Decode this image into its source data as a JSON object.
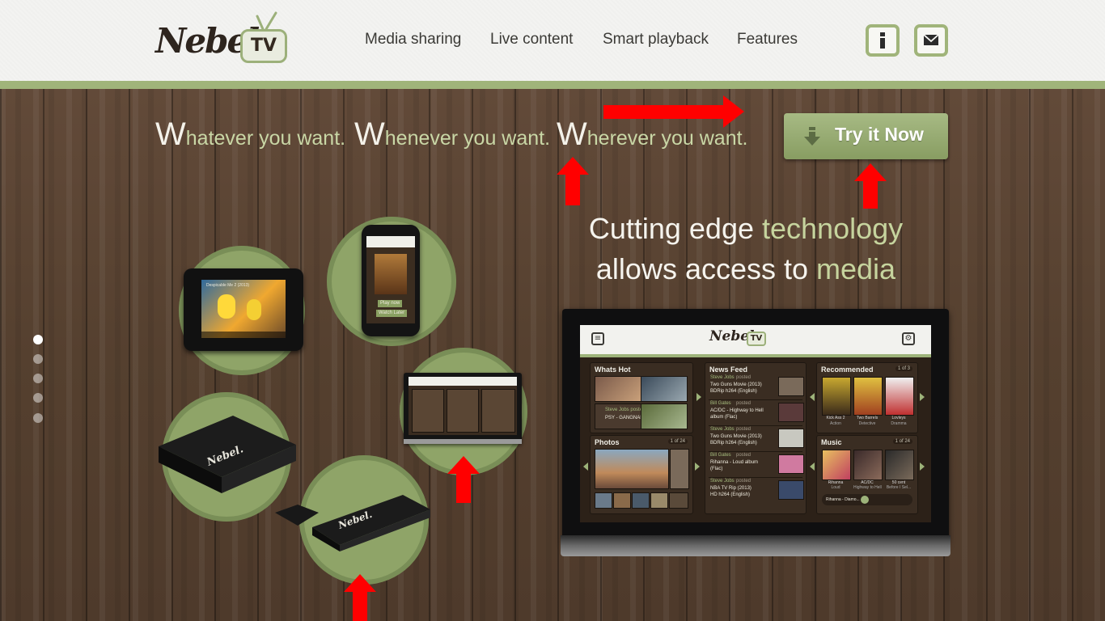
{
  "header": {
    "logo_text": "Nebel.",
    "logo_tv_text": "TV",
    "nav": [
      "Media sharing",
      "Live content",
      "Smart playback",
      "Features"
    ],
    "info_button": "i",
    "mail_button": "mail-icon"
  },
  "tagline": [
    {
      "cap": "W",
      "rest": "hatever you want."
    },
    {
      "cap": "W",
      "rest": "henever you want."
    },
    {
      "cap": "W",
      "rest": "herever you want."
    }
  ],
  "cta": {
    "label": "Try it Now",
    "icon": "download-arrow-icon"
  },
  "headline": {
    "line1_a": "Cutting edge ",
    "line1_b": "technology",
    "line2_a": "allows access to ",
    "line2_b": "media"
  },
  "slider": {
    "count": 5,
    "active": 0
  },
  "tv_ui": {
    "logo_text": "Nebel.",
    "logo_tv_text": "TV",
    "panels": {
      "whats_hot": {
        "title": "Whats Hot",
        "items": [
          "Steve Jobs posted",
          "PSY - GANGNAM STYLE"
        ]
      },
      "news_feed": {
        "title": "News Feed",
        "items": [
          {
            "user": "Steve Jobs",
            "action": "posted",
            "text1": "Two Guns Movie (2013)",
            "text2": "BDRip h264 (English)"
          },
          {
            "user": "Bill Gates",
            "action": "posted",
            "text1": "AC/DC - Highway to Hell",
            "text2": "album (Flac)"
          },
          {
            "user": "Steve Jobs",
            "action": "posted",
            "text1": "Two Guns Movie (2013)",
            "text2": "BDRip h264 (English)"
          },
          {
            "user": "Bill Gates",
            "action": "posted",
            "text1": "Rihanna - Loud album",
            "text2": "(Flac)"
          },
          {
            "user": "Steve Jobs",
            "action": "posted",
            "text1": "NBA TV Rip (2013)",
            "text2": "HD h264 (English)"
          }
        ]
      },
      "recommended": {
        "title": "Recommended",
        "count": "1 of 3",
        "items": [
          {
            "title": "Kick Ass 2",
            "genre": "Action"
          },
          {
            "title": "Two Barrels",
            "genre": "Detective"
          },
          {
            "title": "Lovleys",
            "genre": "Dramma"
          }
        ]
      },
      "photos": {
        "title": "Photos",
        "count": "1 of 24"
      },
      "music": {
        "title": "Music",
        "count": "1 of 24",
        "items": [
          {
            "title": "Rihanna",
            "sub": "Loud"
          },
          {
            "title": "AC/DC",
            "sub": "Highway to Hell"
          },
          {
            "title": "50 cent",
            "sub": "Before I Sel..."
          }
        ],
        "now_playing": "Rihanna - Diamo..."
      }
    }
  },
  "devices": {
    "tablet_caption": "Despicable Me 2 (2013)",
    "phone_buttons": [
      "Play now",
      "Watch Later"
    ],
    "stick_logo": "Nebel.",
    "box_logo": "Nebel."
  },
  "colors": {
    "accent_green": "#a0b47a",
    "headline_green": "#c6d49e",
    "annotation_red": "#ff0000",
    "wood": "#5b4434"
  }
}
